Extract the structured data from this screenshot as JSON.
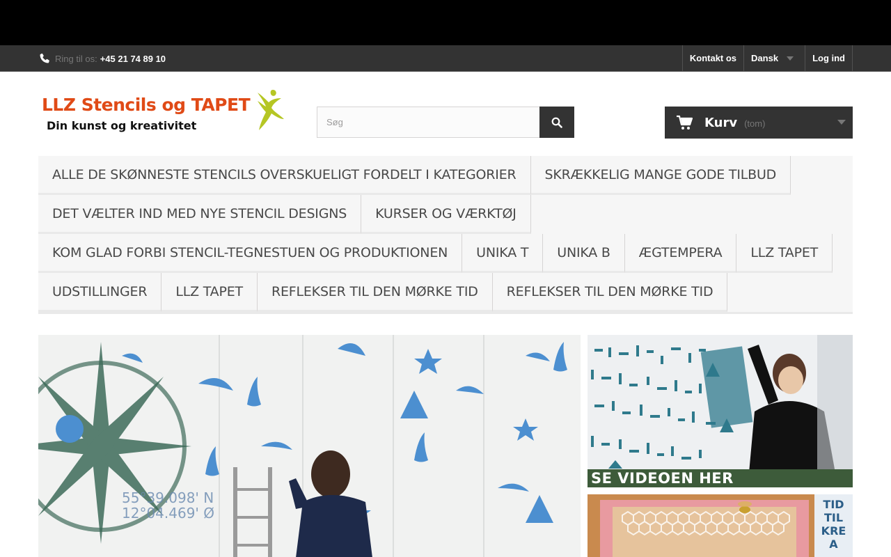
{
  "header": {
    "phone_label": "Ring til os:",
    "phone_number": "+45 21 74 89 10",
    "links": {
      "contact": "Kontakt os",
      "language": "Dansk",
      "login": "Log ind"
    }
  },
  "logo": {
    "line1": "LLZ Stencils og TAPET",
    "line2": "Din kunst og kreativitet"
  },
  "search": {
    "placeholder": "Søg"
  },
  "cart": {
    "label": "Kurv",
    "status": "(tom)"
  },
  "menu": {
    "row1": [
      "Alle de skønneste stencils overskueligt fordelt i kategorier",
      "Skrækkelig mange gode tilbud"
    ],
    "row2": [
      "Det vælter ind med nye stencil designs",
      "Kurser og værktøj"
    ],
    "row3": [
      "Kom glad forbi stencil-tegnestuen og produktionen",
      "Unika T",
      "Unika B",
      "Ægtempera",
      "LLZ TAPET"
    ],
    "row4": [
      "Udstillinger",
      "LLZ TAPET",
      "Reflekser til den mørke tid",
      "Reflekser til den mørke tid"
    ]
  },
  "banners": {
    "main_coords_line1": "55°39.098' N",
    "main_coords_line2": "12°04.469' Ø",
    "video_caption": "SE VIDEOEN HER",
    "tid_lines": [
      "TID",
      "TIL",
      "KRE",
      "A"
    ]
  },
  "colors": {
    "dark_bar": "#333333",
    "logo_orange": "#e04a16",
    "logo_green": "#b5c624",
    "menu_bg": "#f6f6f6"
  }
}
